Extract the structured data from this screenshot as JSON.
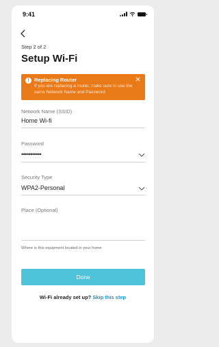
{
  "status": {
    "time": "9:41"
  },
  "nav": {
    "back_icon": "chevron-left-icon"
  },
  "header": {
    "step": "Step 2 of 2",
    "title": "Setup Wi-Fi"
  },
  "alert": {
    "title": "Replacing Router",
    "message": "If you are replacing a router, make sure to use the same Network Name and Password",
    "color": "#ea7a18"
  },
  "form": {
    "ssid": {
      "label": "Network Name (SSID)",
      "value": "Home Wi-fi"
    },
    "password": {
      "label": "Password",
      "value": "•••••••••••"
    },
    "security": {
      "label": "Security Type",
      "value": "WPA2-Personal"
    },
    "place": {
      "label": "Place (Optional)",
      "helper": "Where is this equipment located in your home"
    }
  },
  "actions": {
    "done_label": "Done",
    "done_color": "#4fc3d9",
    "skip_prompt": "Wi-Fi already set up?",
    "skip_link": "Skip this step"
  }
}
